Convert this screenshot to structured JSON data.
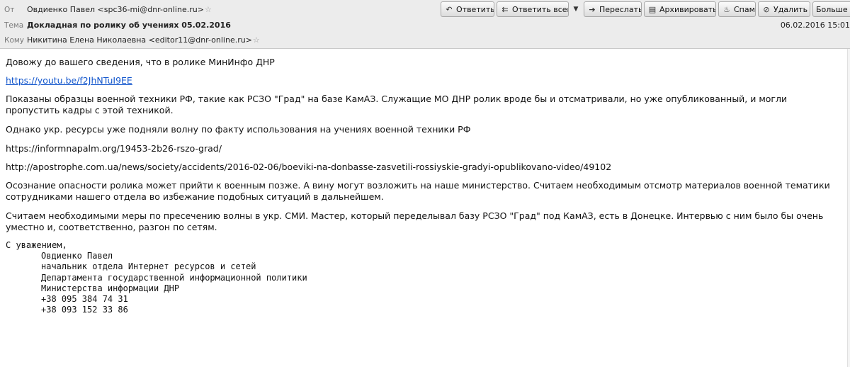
{
  "header": {
    "from_label": "От",
    "from_value": "Овдиенко Павел <spc36-mi@dnr-online.ru>",
    "subject_label": "Тема",
    "subject_value": "Докладная по ролику об учениях 05.02.2016",
    "to_label": "Кому",
    "to_value": "Никитина Елена Николаевна <editor11@dnr-online.ru>",
    "date": "06.02.2016 15:01",
    "star_icon": "star-icon"
  },
  "toolbar": {
    "reply": "Ответить",
    "reply_all": "Ответить всем",
    "forward": "Переслать",
    "archive": "Архивировать",
    "spam": "Спам",
    "delete": "Удалить",
    "more": "Больше"
  },
  "body": {
    "p1": "Довожу до вашего сведения, что в ролике МинИнфо ДНР",
    "link1": "https://youtu.be/f2JhNTuI9EE",
    "p2": "Показаны образцы военной техники РФ, такие как РСЗО \"Град\" на базе КамАЗ. Служащие МО ДНР ролик вроде бы и отсматривали, но уже опубликованный, и могли пропустить кадры с этой техникой.",
    "p3": "Однако укр. ресурсы уже подняли волну по факту использования на учениях военной техники РФ",
    "url2": "https://informnapalm.org/19453-2b26-rszo-grad/",
    "url3": "http://apostrophe.com.ua/news/society/accidents/2016-02-06/boeviki-na-donbasse-zasvetili-rossiyskie-gradyi-opublikovano-video/49102",
    "p4": "Осознание опасности ролика может прийти к военным позже. А вину могут возложить на наше министерство. Считаем необходимым отсмотр материалов военной тематики сотрудниками нашего отдела во избежание подобных ситуаций в дальнейшем.",
    "p5": "Считаем необходимыми меры по пресечению волны в укр. СМИ. Мастер, который переделывал базу РСЗО \"Град\" под КамАЗ, есть в Донецке. Интервью с ним было бы очень уместно и, соответственно, разгон по сетям."
  },
  "signature": {
    "greeting": "С уважением,",
    "name": "Овдиенко Павел",
    "position": "начальник отдела Интернет ресурсов и сетей",
    "department": "Департамента государственной информационной политики",
    "ministry": "Министерства информации ДНР",
    "phone1": "+38 095 384 74 31",
    "phone2": "+38 093 152 33 86"
  }
}
